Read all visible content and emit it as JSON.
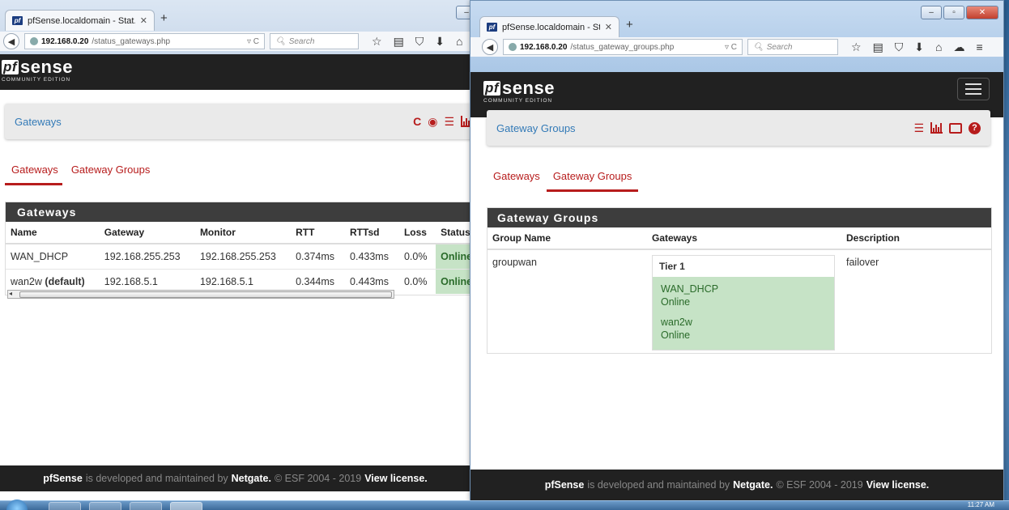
{
  "taskbar": {
    "clock": "11:27 AM"
  },
  "left": {
    "tab_title": "pfSense.localdomain - Stat...",
    "url_host": "192.168.0.20",
    "url_path": "/status_gateways.php",
    "search_placeholder": "Search",
    "breadcrumb": "Gateways",
    "tabs": [
      "Gateways",
      "Gateway Groups"
    ],
    "panel_title": "Gateways",
    "table": {
      "headers": [
        "Name",
        "Gateway",
        "Monitor",
        "RTT",
        "RTTsd",
        "Loss",
        "Status"
      ],
      "rows": [
        {
          "name": "WAN_DHCP",
          "name_suffix": "",
          "gateway": "192.168.255.253",
          "monitor": "192.168.255.253",
          "rtt": "0.374ms",
          "rttsd": "0.433ms",
          "loss": "0.0%",
          "status": "Online"
        },
        {
          "name": "wan2w",
          "name_suffix": "(default)",
          "gateway": "192.168.5.1",
          "monitor": "192.168.5.1",
          "rtt": "0.344ms",
          "rttsd": "0.443ms",
          "loss": "0.0%",
          "status": "Online"
        }
      ]
    }
  },
  "right": {
    "tab_title": "pfSense.localdomain - Stat...",
    "url_host": "192.168.0.20",
    "url_path": "/status_gateway_groups.php",
    "search_placeholder": "Search",
    "breadcrumb": "Gateway Groups",
    "tabs": [
      "Gateways",
      "Gateway Groups"
    ],
    "panel_title": "Gateway Groups",
    "table": {
      "headers": [
        "Group Name",
        "Gateways",
        "Description"
      ],
      "group_name": "groupwan",
      "tier": "Tier 1",
      "members": [
        {
          "name": "WAN_DHCP",
          "status": "Online"
        },
        {
          "name": "wan2w",
          "status": "Online"
        }
      ],
      "description": "failover"
    }
  },
  "brand": {
    "logo_mark": "pf",
    "logo_word": "sense",
    "logo_sub": "COMMUNITY EDITION",
    "colors": {
      "header": "#212121",
      "accent": "#b71c1c",
      "link": "#337ab7",
      "online_bg": "#c6e3c6"
    }
  },
  "footer": {
    "product": "pfSense",
    "text1": "is developed and maintained by",
    "company": "Netgate.",
    "copyright": "© ESF 2004 - 2019",
    "license": "View license."
  }
}
